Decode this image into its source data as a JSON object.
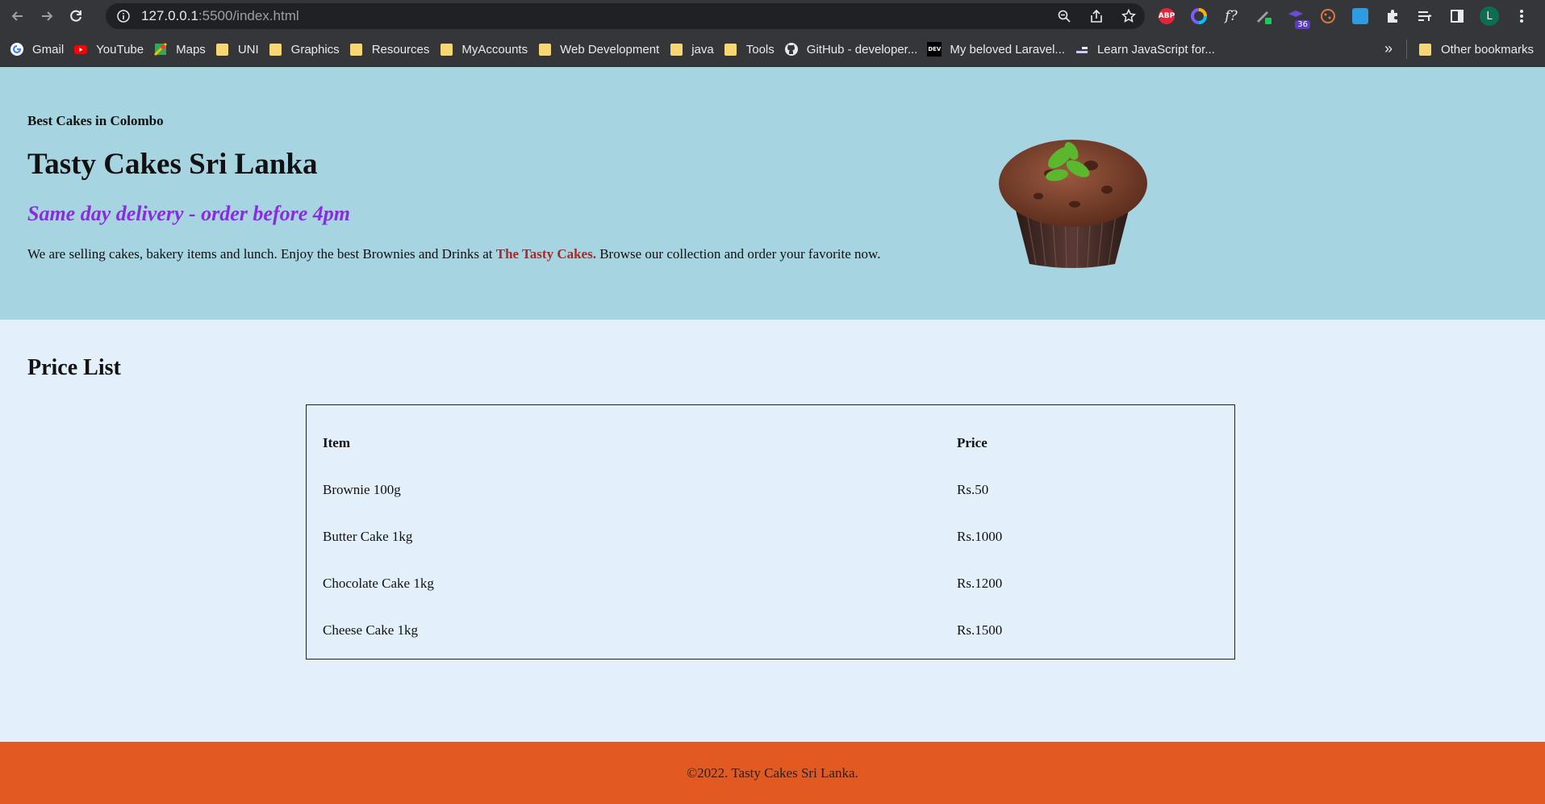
{
  "browser": {
    "url_host": "127.0.0.1",
    "url_path": ":5500/index.html",
    "bookmarks": [
      {
        "label": "Gmail",
        "icon": "gmail-icon"
      },
      {
        "label": "YouTube",
        "icon": "youtube-icon"
      },
      {
        "label": "Maps",
        "icon": "maps-icon"
      },
      {
        "label": "UNI",
        "icon": "folder-icon"
      },
      {
        "label": "Graphics",
        "icon": "folder-icon"
      },
      {
        "label": "Resources",
        "icon": "folder-icon"
      },
      {
        "label": "MyAccounts",
        "icon": "folder-icon"
      },
      {
        "label": "Web Development",
        "icon": "folder-icon"
      },
      {
        "label": "java",
        "icon": "folder-icon"
      },
      {
        "label": "Tools",
        "icon": "folder-icon"
      },
      {
        "label": "GitHub - developer...",
        "icon": "github-icon"
      },
      {
        "label": "My beloved Laravel...",
        "icon": "dev-icon"
      },
      {
        "label": "Learn JavaScript for...",
        "icon": "bookmark-icon"
      }
    ],
    "other_bookmarks": "Other bookmarks",
    "overflow_label": "»",
    "extension_badge": "36",
    "profile_initial": "L",
    "abp_label": "ABP",
    "fx_label": "f?"
  },
  "hero": {
    "kicker": "Best Cakes in Colombo",
    "title": "Tasty Cakes Sri Lanka",
    "tagline": "Same day delivery - order before 4pm",
    "desc_before": "We are selling cakes, bakery items and lunch. Enjoy the best Brownies and Drinks at ",
    "desc_brand": "The Tasty Cakes.",
    "desc_after": " Browse our collection and order your favorite now."
  },
  "price_list": {
    "title": "Price List",
    "headers": {
      "item": "Item",
      "price": "Price"
    },
    "rows": [
      {
        "item": "Brownie 100g",
        "price": "Rs.50"
      },
      {
        "item": "Butter Cake 1kg",
        "price": "Rs.1000"
      },
      {
        "item": "Chocolate Cake 1kg",
        "price": "Rs.1200"
      },
      {
        "item": "Cheese Cake 1kg",
        "price": "Rs.1500"
      }
    ]
  },
  "footer": {
    "text": "©2022. Tasty Cakes Sri Lanka."
  },
  "colors": {
    "hero_bg": "#a6d4e1",
    "page_bg": "#e3f0fb",
    "footer_bg": "#e25a22",
    "tagline": "#8a2be2",
    "brand": "#a52a2a"
  }
}
